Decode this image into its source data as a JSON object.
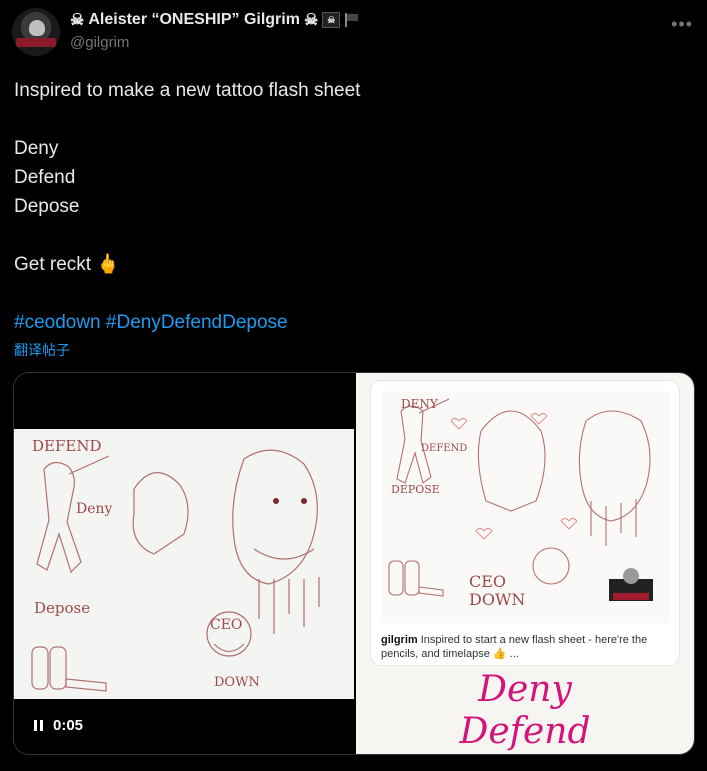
{
  "author": {
    "display_name": "Aleister “ONESHIP” Gilgrim",
    "handle": "@gilgrim",
    "name_prefix_icon": "skull-crossbones-icon",
    "name_suffix_icons": [
      "skull-crossbones-icon",
      "pirate-flag-icon",
      "black-flag-icon"
    ]
  },
  "more_label": "•••",
  "tweet": {
    "line1": "Inspired to make a new tattoo flash sheet",
    "line2": "Deny",
    "line3": "Defend",
    "line4": "Depose",
    "line5": "Get reckt",
    "line5_emoji": "🖕",
    "hashtag1": "#ceodown",
    "hashtag2": "#DenyDefendDepose"
  },
  "translate_label": "翻译帖子",
  "video": {
    "time": "0:05",
    "sketch_labels": {
      "defend": "DEFEND",
      "deny": "Deny",
      "depose": "Depose",
      "ceo": "CEO",
      "down": "DOWN"
    }
  },
  "image_card": {
    "caption_user": "gilgrim",
    "caption_text": " Inspired to start a new flash sheet - here're the pencils, and timelapse 👍 ...",
    "sketch_labels": {
      "deny": "DENY",
      "defend": "DEFEND",
      "depose": "DEPOSE",
      "ceo_down": "CEO DOWN"
    },
    "big_text_1": "Deny",
    "big_text_2": "Defend"
  }
}
